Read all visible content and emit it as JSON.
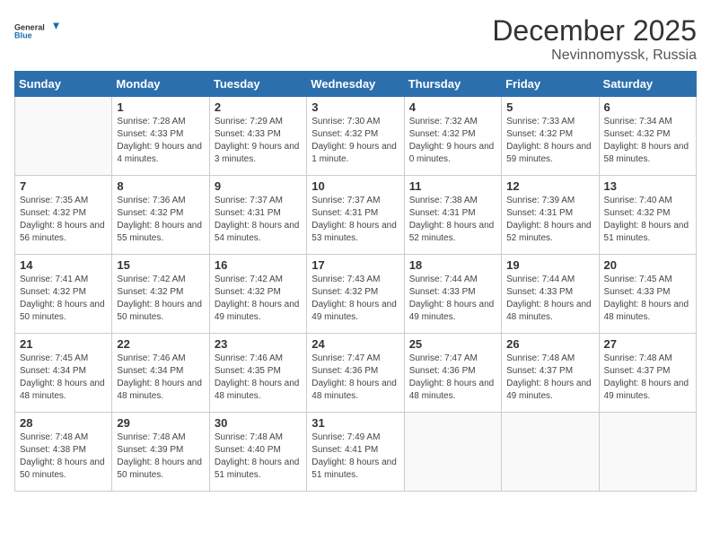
{
  "header": {
    "logo_general": "General",
    "logo_blue": "Blue",
    "month": "December 2025",
    "location": "Nevinnomyssk, Russia"
  },
  "days_of_week": [
    "Sunday",
    "Monday",
    "Tuesday",
    "Wednesday",
    "Thursday",
    "Friday",
    "Saturday"
  ],
  "weeks": [
    [
      {
        "day": "",
        "sunrise": "",
        "sunset": "",
        "daylight": ""
      },
      {
        "day": "1",
        "sunrise": "Sunrise: 7:28 AM",
        "sunset": "Sunset: 4:33 PM",
        "daylight": "Daylight: 9 hours and 4 minutes."
      },
      {
        "day": "2",
        "sunrise": "Sunrise: 7:29 AM",
        "sunset": "Sunset: 4:33 PM",
        "daylight": "Daylight: 9 hours and 3 minutes."
      },
      {
        "day": "3",
        "sunrise": "Sunrise: 7:30 AM",
        "sunset": "Sunset: 4:32 PM",
        "daylight": "Daylight: 9 hours and 1 minute."
      },
      {
        "day": "4",
        "sunrise": "Sunrise: 7:32 AM",
        "sunset": "Sunset: 4:32 PM",
        "daylight": "Daylight: 9 hours and 0 minutes."
      },
      {
        "day": "5",
        "sunrise": "Sunrise: 7:33 AM",
        "sunset": "Sunset: 4:32 PM",
        "daylight": "Daylight: 8 hours and 59 minutes."
      },
      {
        "day": "6",
        "sunrise": "Sunrise: 7:34 AM",
        "sunset": "Sunset: 4:32 PM",
        "daylight": "Daylight: 8 hours and 58 minutes."
      }
    ],
    [
      {
        "day": "7",
        "sunrise": "Sunrise: 7:35 AM",
        "sunset": "Sunset: 4:32 PM",
        "daylight": "Daylight: 8 hours and 56 minutes."
      },
      {
        "day": "8",
        "sunrise": "Sunrise: 7:36 AM",
        "sunset": "Sunset: 4:32 PM",
        "daylight": "Daylight: 8 hours and 55 minutes."
      },
      {
        "day": "9",
        "sunrise": "Sunrise: 7:37 AM",
        "sunset": "Sunset: 4:31 PM",
        "daylight": "Daylight: 8 hours and 54 minutes."
      },
      {
        "day": "10",
        "sunrise": "Sunrise: 7:37 AM",
        "sunset": "Sunset: 4:31 PM",
        "daylight": "Daylight: 8 hours and 53 minutes."
      },
      {
        "day": "11",
        "sunrise": "Sunrise: 7:38 AM",
        "sunset": "Sunset: 4:31 PM",
        "daylight": "Daylight: 8 hours and 52 minutes."
      },
      {
        "day": "12",
        "sunrise": "Sunrise: 7:39 AM",
        "sunset": "Sunset: 4:31 PM",
        "daylight": "Daylight: 8 hours and 52 minutes."
      },
      {
        "day": "13",
        "sunrise": "Sunrise: 7:40 AM",
        "sunset": "Sunset: 4:32 PM",
        "daylight": "Daylight: 8 hours and 51 minutes."
      }
    ],
    [
      {
        "day": "14",
        "sunrise": "Sunrise: 7:41 AM",
        "sunset": "Sunset: 4:32 PM",
        "daylight": "Daylight: 8 hours and 50 minutes."
      },
      {
        "day": "15",
        "sunrise": "Sunrise: 7:42 AM",
        "sunset": "Sunset: 4:32 PM",
        "daylight": "Daylight: 8 hours and 50 minutes."
      },
      {
        "day": "16",
        "sunrise": "Sunrise: 7:42 AM",
        "sunset": "Sunset: 4:32 PM",
        "daylight": "Daylight: 8 hours and 49 minutes."
      },
      {
        "day": "17",
        "sunrise": "Sunrise: 7:43 AM",
        "sunset": "Sunset: 4:32 PM",
        "daylight": "Daylight: 8 hours and 49 minutes."
      },
      {
        "day": "18",
        "sunrise": "Sunrise: 7:44 AM",
        "sunset": "Sunset: 4:33 PM",
        "daylight": "Daylight: 8 hours and 49 minutes."
      },
      {
        "day": "19",
        "sunrise": "Sunrise: 7:44 AM",
        "sunset": "Sunset: 4:33 PM",
        "daylight": "Daylight: 8 hours and 48 minutes."
      },
      {
        "day": "20",
        "sunrise": "Sunrise: 7:45 AM",
        "sunset": "Sunset: 4:33 PM",
        "daylight": "Daylight: 8 hours and 48 minutes."
      }
    ],
    [
      {
        "day": "21",
        "sunrise": "Sunrise: 7:45 AM",
        "sunset": "Sunset: 4:34 PM",
        "daylight": "Daylight: 8 hours and 48 minutes."
      },
      {
        "day": "22",
        "sunrise": "Sunrise: 7:46 AM",
        "sunset": "Sunset: 4:34 PM",
        "daylight": "Daylight: 8 hours and 48 minutes."
      },
      {
        "day": "23",
        "sunrise": "Sunrise: 7:46 AM",
        "sunset": "Sunset: 4:35 PM",
        "daylight": "Daylight: 8 hours and 48 minutes."
      },
      {
        "day": "24",
        "sunrise": "Sunrise: 7:47 AM",
        "sunset": "Sunset: 4:36 PM",
        "daylight": "Daylight: 8 hours and 48 minutes."
      },
      {
        "day": "25",
        "sunrise": "Sunrise: 7:47 AM",
        "sunset": "Sunset: 4:36 PM",
        "daylight": "Daylight: 8 hours and 48 minutes."
      },
      {
        "day": "26",
        "sunrise": "Sunrise: 7:48 AM",
        "sunset": "Sunset: 4:37 PM",
        "daylight": "Daylight: 8 hours and 49 minutes."
      },
      {
        "day": "27",
        "sunrise": "Sunrise: 7:48 AM",
        "sunset": "Sunset: 4:37 PM",
        "daylight": "Daylight: 8 hours and 49 minutes."
      }
    ],
    [
      {
        "day": "28",
        "sunrise": "Sunrise: 7:48 AM",
        "sunset": "Sunset: 4:38 PM",
        "daylight": "Daylight: 8 hours and 50 minutes."
      },
      {
        "day": "29",
        "sunrise": "Sunrise: 7:48 AM",
        "sunset": "Sunset: 4:39 PM",
        "daylight": "Daylight: 8 hours and 50 minutes."
      },
      {
        "day": "30",
        "sunrise": "Sunrise: 7:48 AM",
        "sunset": "Sunset: 4:40 PM",
        "daylight": "Daylight: 8 hours and 51 minutes."
      },
      {
        "day": "31",
        "sunrise": "Sunrise: 7:49 AM",
        "sunset": "Sunset: 4:41 PM",
        "daylight": "Daylight: 8 hours and 51 minutes."
      },
      {
        "day": "",
        "sunrise": "",
        "sunset": "",
        "daylight": ""
      },
      {
        "day": "",
        "sunrise": "",
        "sunset": "",
        "daylight": ""
      },
      {
        "day": "",
        "sunrise": "",
        "sunset": "",
        "daylight": ""
      }
    ]
  ]
}
